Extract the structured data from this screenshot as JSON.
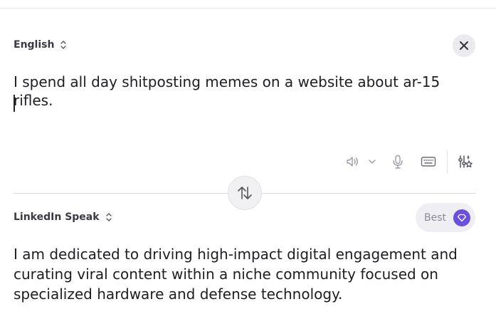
{
  "source": {
    "language": "English",
    "text": "I spend all day shitposting memes on a website about ar-15 rifles."
  },
  "target": {
    "language": "LinkedIn Speak",
    "quality_label": "Best",
    "text": "I am dedicated to driving high-impact digital engagement and curating viral content within a niche community focused on specialized hardware and defense technology."
  },
  "toolbar": {
    "icons": [
      "speaker-icon",
      "chevron-down-icon",
      "microphone-icon",
      "keyboard-icon",
      "settings-sliders-icon"
    ]
  },
  "colors": {
    "accent": "#6d4fe0",
    "divider": "#d7d7dc",
    "pill_bg": "#efeff3"
  }
}
